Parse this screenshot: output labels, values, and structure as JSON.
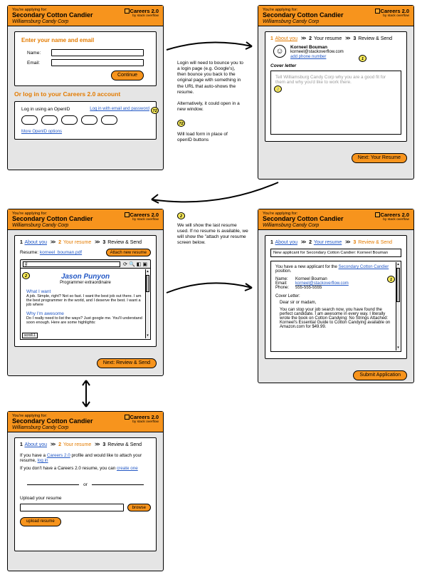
{
  "common": {
    "applying": "You're applying for:",
    "title": "Secondary Cotton Candier",
    "company": "Williamsburg Candy Corp",
    "logo": "Careers 2.0",
    "logoBy": "by stack overflow"
  },
  "steps": {
    "n1": "1",
    "s1": "About you",
    "n2": "2",
    "s2": "Your resume",
    "n3": "3",
    "s3": "Review & Send",
    "sep": ">>"
  },
  "screen1": {
    "heading": "Enter your name and email",
    "name": "Name:",
    "email": "Email:",
    "continue": "Continue",
    "or": "Or log in to your Careers 2.0 account",
    "openid": "Log in using an OpenID",
    "emailpw": "Log in with email and password",
    "more": "More OpenID options",
    "annot": "?2"
  },
  "notesA": {
    "a1": "Login will need to bounce you to a login page (e.g. Google's), then bounce you back to the original page with something in the URL that auto-shows the resume.",
    "a2": "Alternatively, it could open in a new window.",
    "a3": "Will load form in place of openID buttons",
    "bubble": "?2"
  },
  "screen2": {
    "user": "Korneel Bouman",
    "email": "korneel@stackoverflow.com",
    "addphone": "add phone number",
    "cover": "Cover letter",
    "placeholder": "Tell Williamsburg Candy Corp why you are a good fit for them and why you'd like to work there.",
    "annot1": "1",
    "annot2": "2",
    "next": "Next: Your Resume"
  },
  "notesB": {
    "bubble": "2",
    "text": "We will show the last resume used. If no resume is available, we will show the \"attach your resume screen below."
  },
  "screen3": {
    "resume": "Resume:",
    "resumefile": "korneel_bouman.pdf",
    "attach": "Attach new resume",
    "url": "g",
    "name": "Jason Punyon",
    "subtitle": "Programmer extraordinaire",
    "h1": "What I want",
    "p1": "A job. Simple, right? Not so fast. I want the best job out there. I am the best programmer in the world, and I deserve the best. I want a job where",
    "h2": "Why I'm awesome",
    "p2": "Do I really need to list the ways? Just google me. You'll understand soon enough. Here are some highlights:",
    "annot": "2",
    "scroll": "scroll.1",
    "next": "Next: Review & Send"
  },
  "screen4": {
    "banner": "New applicant for Secondary Cotton Candier: Korneel Bouman",
    "intro1": "You have a new applicant for the ",
    "introLink": "Secondary Cotton Candier",
    "intro2": " position.",
    "nLabel": "Name:",
    "nVal": "Korneel Bouman",
    "eLabel": "Email:",
    "eVal": "korneel@stackoverflow.com",
    "pLabel": "Phone:",
    "pVal": "555-555-5555",
    "clLabel": "Cover Letter:",
    "clGreeting": "Dear sir or madam,",
    "clBody": "You can stop your job search now, you have found the perfect candidate. I am awesome in every way. I literally wrote the book on Cotton Candying: No Strings Attached: Korneel's Essential Guide to Cotton Candying available on Amazon.com for $49.99.",
    "annot": "1",
    "submit": "Submit Application"
  },
  "screen5": {
    "line1a": "If you have a ",
    "line1link": "Careers 2.0",
    "line1b": " profile and would like to attach your resume, ",
    "line1c": "log in",
    "line2": "If you don't have a Careers 2.0 resume, you can ",
    "line2link": "create one",
    "or": "or",
    "upload": "Upload your resume",
    "browse": "browse",
    "uploadbtn": "upload resume"
  }
}
